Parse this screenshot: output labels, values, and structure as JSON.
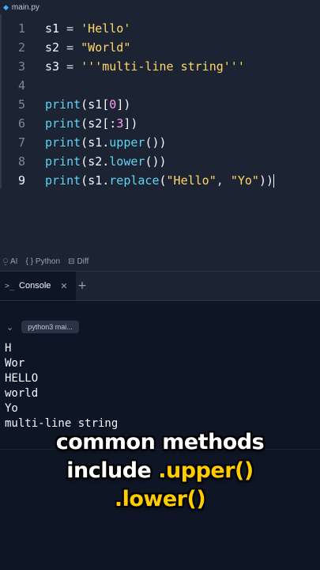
{
  "file_tab": {
    "name": "main.py",
    "icon": "python-file-icon"
  },
  "editor": {
    "lines": [
      {
        "num": "1",
        "tokens": [
          [
            "var",
            "s1"
          ],
          [
            "op",
            " = "
          ],
          [
            "str",
            "'Hello'"
          ]
        ]
      },
      {
        "num": "2",
        "tokens": [
          [
            "var",
            "s2"
          ],
          [
            "op",
            " = "
          ],
          [
            "str",
            "\"World\""
          ]
        ]
      },
      {
        "num": "3",
        "tokens": [
          [
            "var",
            "s3"
          ],
          [
            "op",
            " = "
          ],
          [
            "str",
            "'''multi-line string'''"
          ]
        ]
      },
      {
        "num": "4",
        "tokens": []
      },
      {
        "num": "5",
        "tokens": [
          [
            "fn",
            "print"
          ],
          [
            "paren",
            "("
          ],
          [
            "var",
            "s1"
          ],
          [
            "paren",
            "["
          ],
          [
            "num",
            "0"
          ],
          [
            "paren",
            "])"
          ]
        ]
      },
      {
        "num": "6",
        "tokens": [
          [
            "fn",
            "print"
          ],
          [
            "paren",
            "("
          ],
          [
            "var",
            "s2"
          ],
          [
            "paren",
            "[:"
          ],
          [
            "num",
            "3"
          ],
          [
            "paren",
            "])"
          ]
        ]
      },
      {
        "num": "7",
        "tokens": [
          [
            "fn",
            "print"
          ],
          [
            "paren",
            "("
          ],
          [
            "var",
            "s1."
          ],
          [
            "meth",
            "upper"
          ],
          [
            "paren",
            "())"
          ]
        ]
      },
      {
        "num": "8",
        "tokens": [
          [
            "fn",
            "print"
          ],
          [
            "paren",
            "("
          ],
          [
            "var",
            "s2."
          ],
          [
            "meth",
            "lower"
          ],
          [
            "paren",
            "())"
          ]
        ]
      },
      {
        "num": "9",
        "tokens": [
          [
            "fn",
            "print"
          ],
          [
            "paren",
            "("
          ],
          [
            "var",
            "s1."
          ],
          [
            "meth",
            "replace"
          ],
          [
            "paren",
            "("
          ],
          [
            "str",
            "\"Hello\""
          ],
          [
            "op",
            ", "
          ],
          [
            "str",
            "\"Yo\""
          ],
          [
            "paren",
            "))"
          ]
        ],
        "active": true
      }
    ]
  },
  "statusbar": {
    "ai_label": "AI",
    "python_label": "Python",
    "diff_label": "Diff"
  },
  "console": {
    "tab_label": "Console",
    "shell_label": "python3 mai...",
    "output": [
      "H",
      "Wor",
      "HELLO",
      "world",
      "Yo",
      "multi-line string"
    ]
  },
  "caption": {
    "line1": "common methods",
    "line2_plain": "include ",
    "line2_highlight": ".upper()",
    "line3_highlight": ".lower()"
  },
  "colors": {
    "editor_bg": "#1c2333",
    "console_bg": "#0e1525",
    "string": "#ffd866",
    "number": "#ff9cf2",
    "function": "#5fd4f4",
    "caption_highlight": "#ffcc00"
  }
}
